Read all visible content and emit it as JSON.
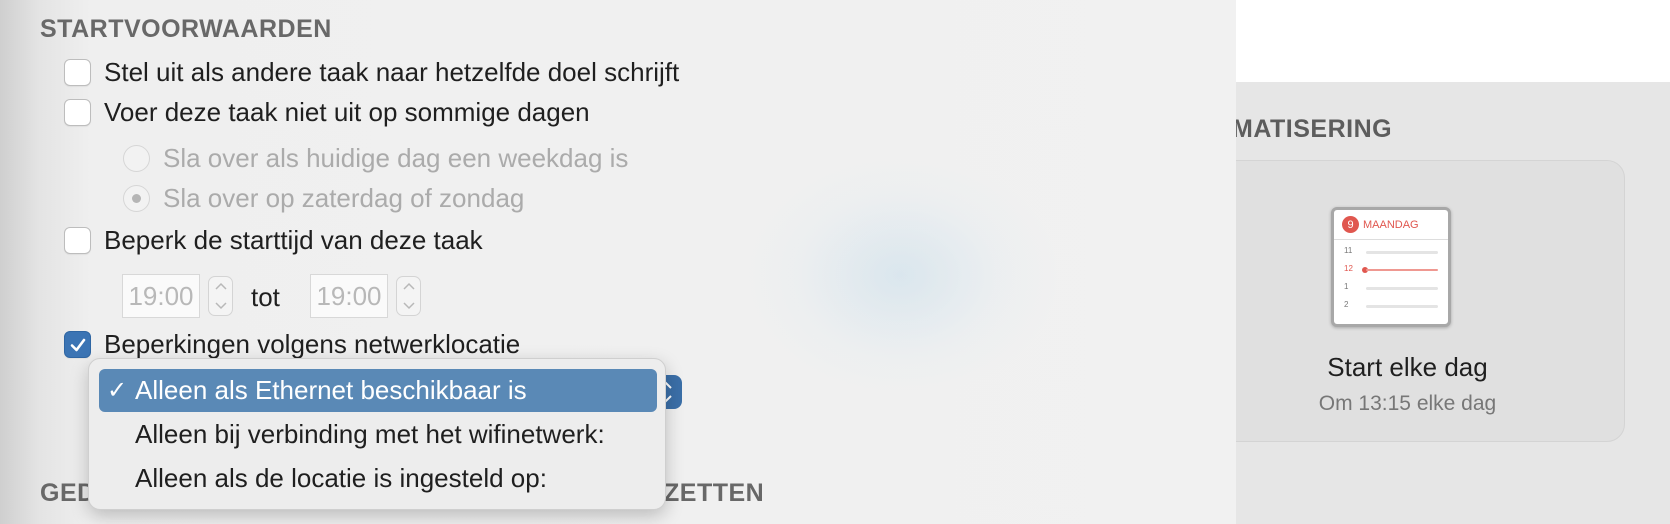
{
  "startvoorwaarden": {
    "heading": "STARTVOORWAARDEN",
    "defer_label": "Stel uit als andere taak naar hetzelfde doel schrijft",
    "skip_days_label": "Voer deze taak niet uit op sommige dagen",
    "skip_weekday_label": "Sla over als huidige dag een weekdag is",
    "skip_weekend_label": "Sla over op zaterdag of zondag",
    "limit_time_label": "Beperk de starttijd van deze taak",
    "time_from": "19:00",
    "time_to_label": "tot",
    "time_to": "19:00",
    "network_label": "Beperkingen volgens netwerklocatie"
  },
  "network_menu": {
    "selected_check": "✓",
    "items": [
      "Alleen als Ethernet beschikbaar is",
      "Alleen bij verbinding met het wifinetwerk:",
      "Alleen als de locatie is ingesteld op:"
    ]
  },
  "bottom_heading_left": "GED",
  "bottom_heading_right": "ZETTEN",
  "automation": {
    "heading": "MATISERING",
    "calendar_day": "9",
    "calendar_month": "MAANDAG",
    "calendar_rows": [
      "11",
      "12",
      "1",
      "2"
    ],
    "trigger_title": "Start elke dag",
    "trigger_subtitle": "Om 13:15 elke dag"
  },
  "colors": {
    "accent": "#3b74b4",
    "menu_selected": "#5a89b6",
    "calendar_red": "#e0574f"
  }
}
